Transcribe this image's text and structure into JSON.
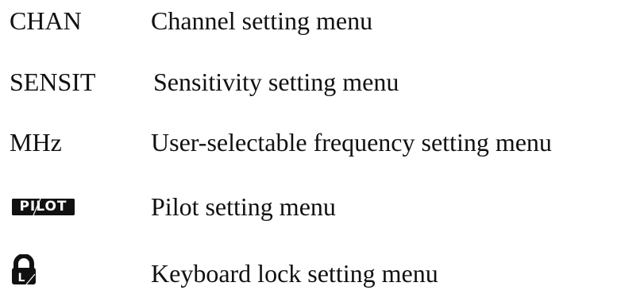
{
  "rows": [
    {
      "term": "CHAN",
      "description": "Channel setting menu"
    },
    {
      "term": "SENSIT",
      "description": "Sensitivity setting menu"
    },
    {
      "term": "MHz",
      "description": "User-selectable frequency setting menu"
    },
    {
      "term": "PILOT",
      "icon": "pilot-badge",
      "description": "Pilot setting menu"
    },
    {
      "term": "L",
      "icon": "keyboard-lock-icon",
      "description": "Keyboard lock setting menu"
    }
  ],
  "colors": {
    "text": "#111111",
    "badge_background": "#111111",
    "badge_text": "#ffffff"
  }
}
